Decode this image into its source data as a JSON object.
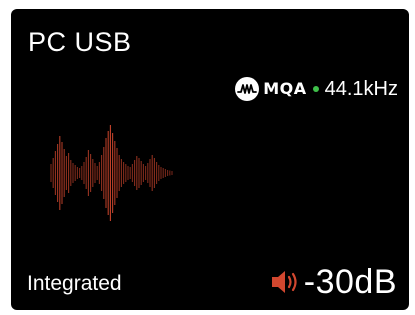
{
  "display": {
    "source": "PC USB",
    "format": {
      "logo_icon": "mqa-logo-icon",
      "badge": "MQA",
      "indicator_color": "#3fc04a",
      "sample_rate": "44.1kHz"
    },
    "visualizer": {
      "icon": "waveform-visualizer",
      "color": "#c8442c"
    },
    "mode": "Integrated",
    "volume": {
      "icon": "speaker-icon",
      "icon_color": "#d2472f",
      "value": "-30dB"
    }
  }
}
